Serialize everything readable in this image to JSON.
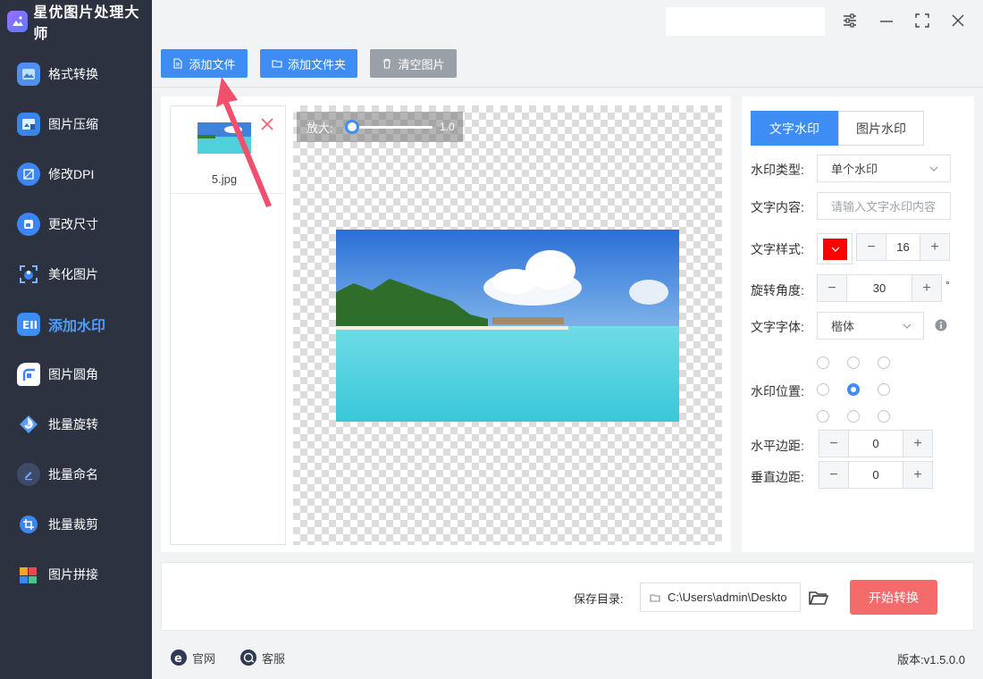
{
  "app": {
    "title": "星优图片处理大师"
  },
  "sidebar": {
    "items": [
      {
        "label": "格式转换",
        "icon": "image-convert-icon"
      },
      {
        "label": "图片压缩",
        "icon": "image-compress-icon"
      },
      {
        "label": "修改DPI",
        "icon": "dpi-icon"
      },
      {
        "label": "更改尺寸",
        "icon": "resize-icon"
      },
      {
        "label": "美化图片",
        "icon": "beautify-icon"
      },
      {
        "label": "添加水印",
        "icon": "watermark-icon",
        "active": true
      },
      {
        "label": "图片圆角",
        "icon": "rounded-corner-icon"
      },
      {
        "label": "批量旋转",
        "icon": "rotate-icon"
      },
      {
        "label": "批量命名",
        "icon": "rename-icon"
      },
      {
        "label": "批量裁剪",
        "icon": "crop-icon"
      },
      {
        "label": "图片拼接",
        "icon": "puzzle-icon"
      }
    ]
  },
  "toolbar": {
    "add_file": "添加文件",
    "add_folder": "添加文件夹",
    "clear_images": "清空图片"
  },
  "files": [
    {
      "name": "5.jpg"
    }
  ],
  "zoom": {
    "label": "放大:",
    "value": "1.0",
    "fraction": 0.0
  },
  "settings": {
    "tabs": {
      "text": "文字水印",
      "image": "图片水印"
    },
    "type": {
      "label": "水印类型:",
      "value": "单个水印"
    },
    "content": {
      "label": "文字内容:",
      "placeholder": "请输入文字水印内容"
    },
    "style": {
      "label": "文字样式:",
      "color": "#ff0000",
      "size": "16"
    },
    "rotation": {
      "label": "旋转角度:",
      "value": "30",
      "unit": "°"
    },
    "font": {
      "label": "文字字体:",
      "value": "楷体"
    },
    "position": {
      "label": "水印位置:",
      "selected_row": 1,
      "selected_col": 1
    },
    "h_margin": {
      "label": "水平边距:",
      "value": "0"
    },
    "v_margin": {
      "label": "垂直边距:",
      "value": "0"
    }
  },
  "output": {
    "save_label": "保存目录:",
    "path": "C:\\Users\\admin\\Deskto",
    "start": "开始转换"
  },
  "footer": {
    "website": "官网",
    "support": "客服",
    "version": "版本:v1.5.0.0"
  },
  "colors": {
    "accent": "#3d8df5",
    "sidebar_bg": "#2d3240",
    "start_btn": "#f36b6b",
    "annotation_arrow": "#f0506e"
  }
}
